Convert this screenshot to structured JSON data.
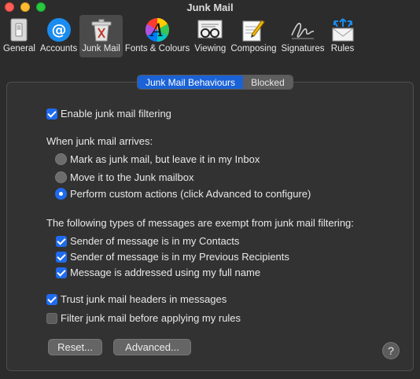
{
  "window": {
    "title": "Junk Mail"
  },
  "toolbar": {
    "items": [
      {
        "label": "General",
        "icon": "switch-icon"
      },
      {
        "label": "Accounts",
        "icon": "at-sign-icon"
      },
      {
        "label": "Junk Mail",
        "icon": "trash-bin-icon",
        "active": true
      },
      {
        "label": "Fonts & Colours",
        "icon": "color-wheel-icon"
      },
      {
        "label": "Viewing",
        "icon": "glasses-icon"
      },
      {
        "label": "Composing",
        "icon": "pencil-note-icon"
      },
      {
        "label": "Signatures",
        "icon": "signature-icon"
      },
      {
        "label": "Rules",
        "icon": "envelope-arrows-icon"
      }
    ]
  },
  "tabs": [
    {
      "label": "Junk Mail Behaviours",
      "selected": true
    },
    {
      "label": "Blocked",
      "selected": false
    }
  ],
  "settings": {
    "enable_filtering": {
      "label": "Enable junk mail filtering",
      "checked": true
    },
    "arrives_heading": "When junk mail arrives:",
    "radio": [
      {
        "label": "Mark as junk mail, but leave it in my Inbox",
        "selected": false
      },
      {
        "label": "Move it to the Junk mailbox",
        "selected": false
      },
      {
        "label": "Perform custom actions (click Advanced to configure)",
        "selected": true
      }
    ],
    "exempt_heading": "The following types of messages are exempt from junk mail filtering:",
    "exempt": [
      {
        "label": "Sender of message is in my Contacts",
        "checked": true
      },
      {
        "label": "Sender of message is in my Previous Recipients",
        "checked": true
      },
      {
        "label": "Message is addressed using my full name",
        "checked": true
      }
    ],
    "trust_headers": {
      "label": "Trust junk mail headers in messages",
      "checked": true
    },
    "filter_before_rules": {
      "label": "Filter junk mail before applying my rules",
      "checked": false
    }
  },
  "buttons": {
    "reset": "Reset...",
    "advanced": "Advanced...",
    "help": "?"
  },
  "colors": {
    "accent": "#1f6bef",
    "window_bg": "#2c2c2c",
    "panel_bg": "#323232"
  }
}
